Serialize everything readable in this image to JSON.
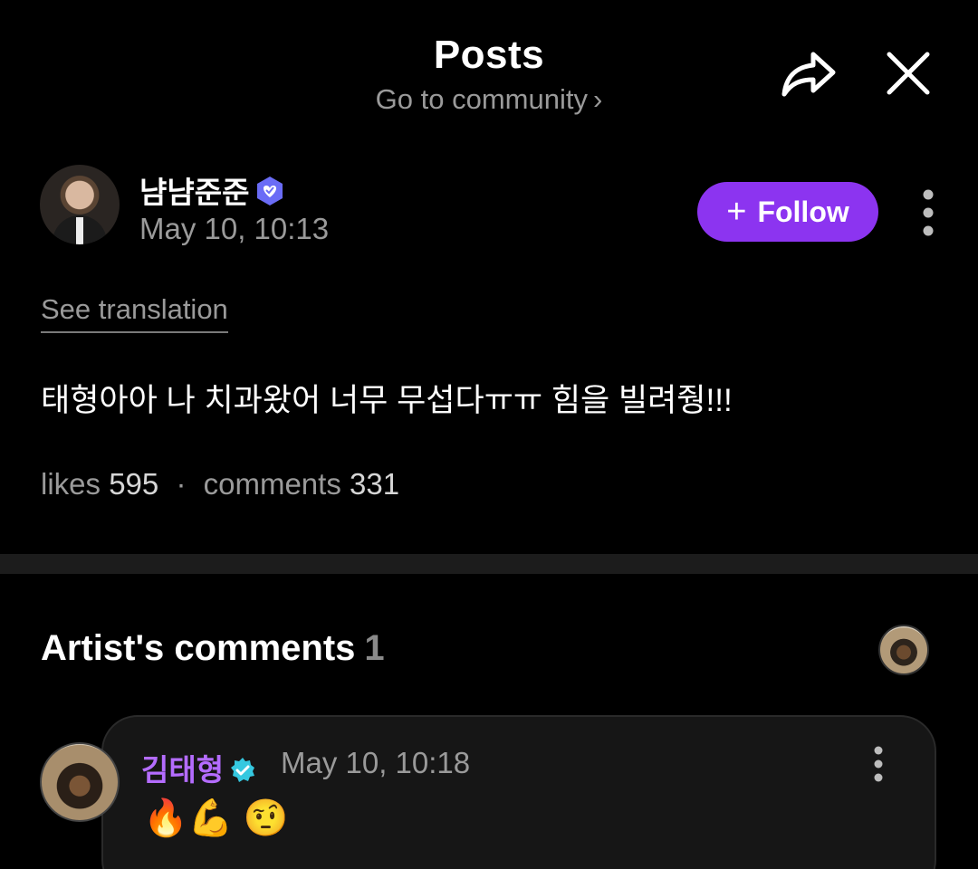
{
  "header": {
    "title": "Posts",
    "subtitle": "Go to community",
    "subtitle_chevron": "›"
  },
  "post": {
    "author": "냠냠준준",
    "time": "May 10, 10:13",
    "follow_label": "Follow",
    "follow_plus": "+",
    "see_translation": "See translation",
    "body": "태형아아 나 치과왔어 너무 무섭다ㅠㅠ 힘을 빌려줭!!!",
    "likes_label": "likes",
    "likes_count": "595",
    "comments_label": "comments",
    "comments_count": "331",
    "separator": "·"
  },
  "artist_comments": {
    "title": "Artist's comments",
    "count": "1",
    "comment": {
      "author": "김태형",
      "time": "May 10, 10:18",
      "text": "🔥💪 🤨"
    }
  },
  "colors": {
    "accent": "#8c34f0",
    "verified_blue": "#6a6cf6",
    "verified_teal": "#35c8e0",
    "artist_name": "#b46cff",
    "muted": "#9a9a9a"
  },
  "icons": [
    "share-icon",
    "close-icon",
    "verified-badge-icon",
    "more-vertical-icon",
    "chevron-right-icon"
  ]
}
